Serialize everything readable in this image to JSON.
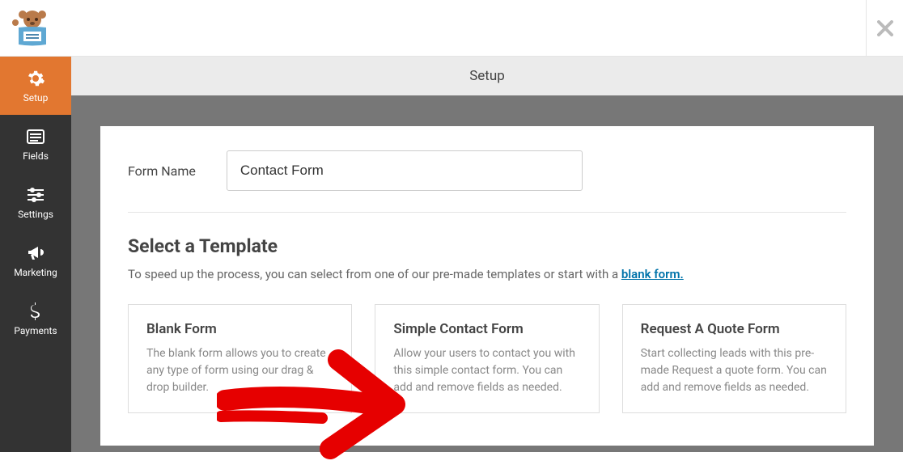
{
  "header": {
    "page_title": "Setup"
  },
  "sidebar": {
    "items": [
      {
        "label": "Setup",
        "icon": "gear"
      },
      {
        "label": "Fields",
        "icon": "list"
      },
      {
        "label": "Settings",
        "icon": "sliders"
      },
      {
        "label": "Marketing",
        "icon": "megaphone"
      },
      {
        "label": "Payments",
        "icon": "dollar"
      }
    ]
  },
  "form": {
    "name_label": "Form Name",
    "name_value": "Contact Form"
  },
  "template_section": {
    "heading": "Select a Template",
    "description_prefix": "To speed up the process, you can select from one of our pre-made templates or start with a ",
    "description_link": "blank form."
  },
  "templates": [
    {
      "title": "Blank Form",
      "desc": "The blank form allows you to create any type of form using our drag & drop builder."
    },
    {
      "title": "Simple Contact Form",
      "desc": "Allow your users to contact you with this simple contact form. You can add and remove fields as needed."
    },
    {
      "title": "Request A Quote Form",
      "desc": "Start collecting leads with this pre-made Request a quote form. You can add and remove fields as needed."
    }
  ]
}
